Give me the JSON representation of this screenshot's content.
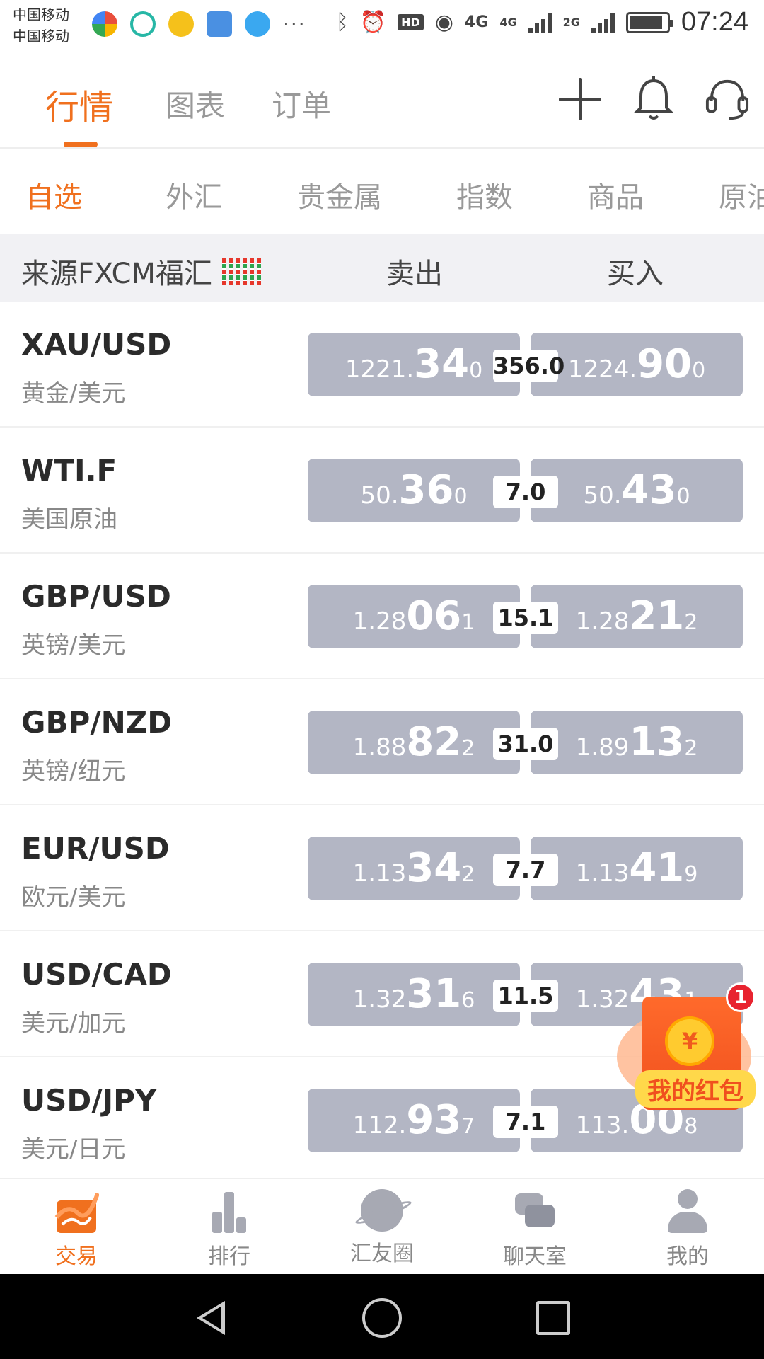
{
  "status_bar": {
    "carrier_1": "中国移动",
    "carrier_2": "中国移动",
    "network_1": "4G",
    "network_2": "4G",
    "network_3": "2G",
    "hd_tag": "HD",
    "more": "···",
    "time": "07:24"
  },
  "top_tabs": [
    "行情",
    "图表",
    "订单"
  ],
  "categories": [
    "自选",
    "外汇",
    "贵金属",
    "指数",
    "商品",
    "原油"
  ],
  "list_header": {
    "source": "来源FXCM福汇",
    "sell": "卖出",
    "buy": "买入"
  },
  "quotes": [
    {
      "symbol": "XAU/USD",
      "name": "黄金/美元",
      "sell": {
        "pre": "1221.",
        "big": "34",
        "sub": "0"
      },
      "spread": "356.0",
      "buy": {
        "pre": "1224.",
        "big": "90",
        "sub": "0"
      }
    },
    {
      "symbol": "WTI.F",
      "name": "美国原油",
      "sell": {
        "pre": "50.",
        "big": "36",
        "sub": "0"
      },
      "spread": "7.0",
      "buy": {
        "pre": "50.",
        "big": "43",
        "sub": "0"
      }
    },
    {
      "symbol": "GBP/USD",
      "name": "英镑/美元",
      "sell": {
        "pre": "1.28",
        "big": "06",
        "sub": "1"
      },
      "spread": "15.1",
      "buy": {
        "pre": "1.28",
        "big": "21",
        "sub": "2"
      }
    },
    {
      "symbol": "GBP/NZD",
      "name": "英镑/纽元",
      "sell": {
        "pre": "1.88",
        "big": "82",
        "sub": "2"
      },
      "spread": "31.0",
      "buy": {
        "pre": "1.89",
        "big": "13",
        "sub": "2"
      }
    },
    {
      "symbol": "EUR/USD",
      "name": "欧元/美元",
      "sell": {
        "pre": "1.13",
        "big": "34",
        "sub": "2"
      },
      "spread": "7.7",
      "buy": {
        "pre": "1.13",
        "big": "41",
        "sub": "9"
      }
    },
    {
      "symbol": "USD/CAD",
      "name": "美元/加元",
      "sell": {
        "pre": "1.32",
        "big": "31",
        "sub": "6"
      },
      "spread": "11.5",
      "buy": {
        "pre": "1.32",
        "big": "43",
        "sub": "1"
      }
    },
    {
      "symbol": "USD/JPY",
      "name": "美元/日元",
      "sell": {
        "pre": "112.",
        "big": "93",
        "sub": "7"
      },
      "spread": "7.1",
      "buy": {
        "pre": "113.",
        "big": "00",
        "sub": "8"
      }
    }
  ],
  "red_packet": {
    "label": "我的红包",
    "coin": "¥",
    "badge": "1"
  },
  "bottom_nav": [
    "交易",
    "排行",
    "汇友圈",
    "聊天室",
    "我的"
  ],
  "colors": {
    "accent": "#f0701e",
    "price_box": "#b3b6c4",
    "badge": "#e8232f"
  }
}
